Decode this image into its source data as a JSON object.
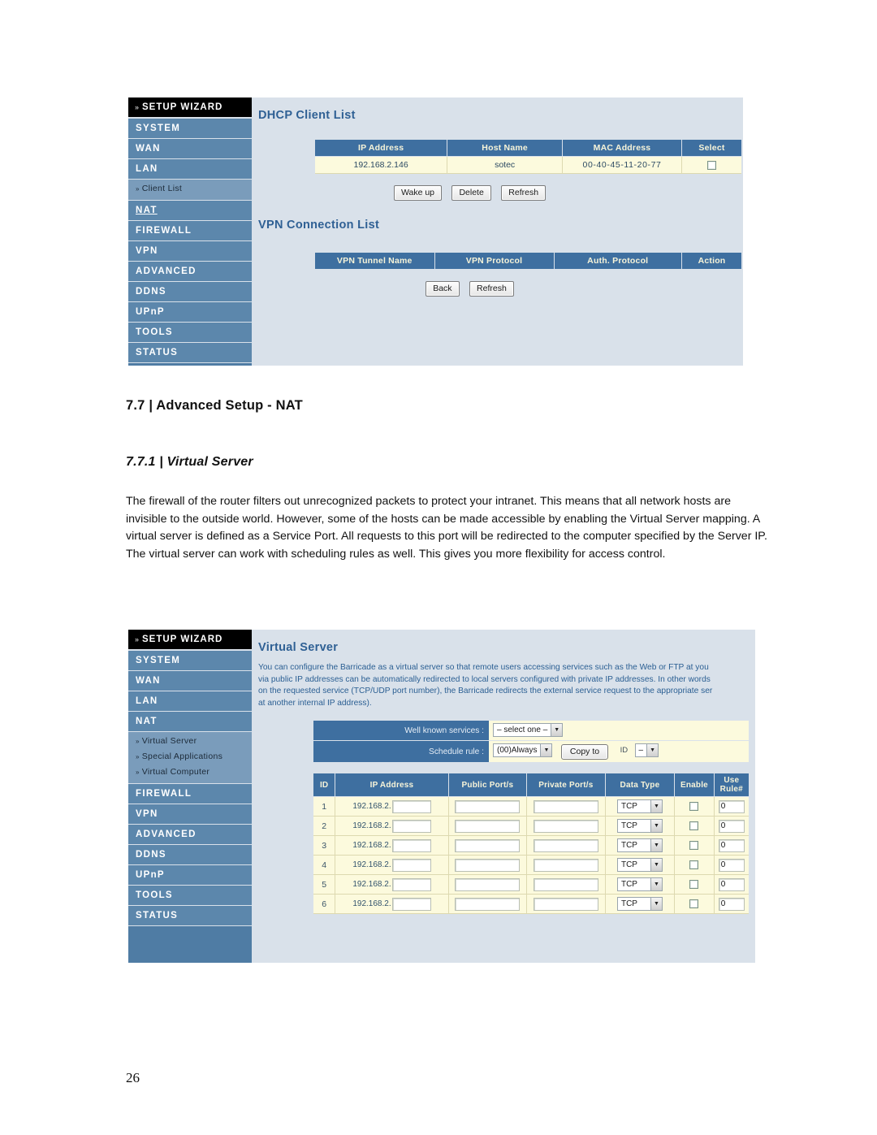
{
  "document": {
    "heading": "7.7 | Advanced Setup - NAT",
    "subheading": "7.7.1 | Virtual Server",
    "paragraph1": "The firewall of the router filters out unrecognized packets to protect your intranet. This means that all network hosts are invisible to the outside world. However, some of the hosts can be made accessible by enabling the Virtual Server mapping. A virtual server is defined as a Service Port. All requests to this port will be redirected to the computer specified by the Server IP.",
    "paragraph2": "The virtual server can work with scheduling rules as well. This gives you more flexibility for access control.",
    "page_number": "26"
  },
  "colors": {
    "sidebar_bg": "#4f7ca4",
    "nav_item_bg": "#5c87ac",
    "sub_group_bg": "#7a9cbb",
    "content_bg": "#d9e1ea",
    "table_header_bg": "#3e6fa0",
    "table_header_text": "#f7f4d9",
    "table_cell_bg": "#fcfadd",
    "title_text": "#2f6094"
  },
  "screenshot1": {
    "sidebar": {
      "wizard_label": "SETUP WIZARD",
      "chevron": "»",
      "items": [
        {
          "label": "SYSTEM",
          "type": "main"
        },
        {
          "label": "WAN",
          "type": "main"
        },
        {
          "label": "LAN",
          "type": "main"
        },
        {
          "label": "Client List",
          "type": "sub"
        },
        {
          "label": "NAT",
          "type": "main",
          "state": "underlined"
        },
        {
          "label": "FIREWALL",
          "type": "main"
        },
        {
          "label": "VPN",
          "type": "main"
        },
        {
          "label": "ADVANCED",
          "type": "main"
        },
        {
          "label": "DDNS",
          "type": "main"
        },
        {
          "label": "UPnP",
          "type": "main"
        },
        {
          "label": "TOOLS",
          "type": "main"
        },
        {
          "label": "STATUS",
          "type": "main"
        }
      ]
    },
    "dhcp": {
      "title": "DHCP Client List",
      "columns": [
        "IP Address",
        "Host Name",
        "MAC Address",
        "Select"
      ],
      "rows": [
        {
          "ip": "192.168.2.146",
          "host": "sotec",
          "mac": "00-40-45-11-20-77",
          "selected": false
        }
      ],
      "buttons": [
        "Wake up",
        "Delete",
        "Refresh"
      ]
    },
    "vpn": {
      "title": "VPN Connection List",
      "columns": [
        "VPN Tunnel Name",
        "VPN Protocol",
        "Auth. Protocol",
        "Action"
      ],
      "rows": [],
      "buttons": [
        "Back",
        "Refresh"
      ]
    }
  },
  "screenshot2": {
    "sidebar": {
      "wizard_label": "SETUP WIZARD",
      "chevron": "»",
      "items": [
        {
          "label": "SYSTEM",
          "type": "main"
        },
        {
          "label": "WAN",
          "type": "main"
        },
        {
          "label": "LAN",
          "type": "main"
        },
        {
          "label": "NAT",
          "type": "main"
        },
        {
          "label": "Virtual Server",
          "type": "sub"
        },
        {
          "label": "Special Applications",
          "type": "sub"
        },
        {
          "label": "Virtual Computer",
          "type": "sub"
        },
        {
          "label": "FIREWALL",
          "type": "main"
        },
        {
          "label": "VPN",
          "type": "main"
        },
        {
          "label": "ADVANCED",
          "type": "main"
        },
        {
          "label": "DDNS",
          "type": "main"
        },
        {
          "label": "UPnP",
          "type": "main"
        },
        {
          "label": "TOOLS",
          "type": "main"
        },
        {
          "label": "STATUS",
          "type": "main"
        }
      ]
    },
    "panel": {
      "title": "Virtual Server",
      "description_lines": [
        "You can configure the Barricade as a virtual server so that remote users accessing services such as the Web or FTP at you",
        "via public IP addresses can be automatically redirected to local servers configured with private IP addresses. In other words",
        "on the requested service (TCP/UDP port number), the Barricade redirects the external service request to the appropriate ser",
        "at another internal IP address)."
      ],
      "form": {
        "well_known_label": "Well known services :",
        "well_known_value": "– select one –",
        "schedule_label": "Schedule rule :",
        "schedule_value": "(00)Always",
        "copy_button": "Copy to",
        "id_label": "ID",
        "id_value": "–"
      },
      "table": {
        "columns": [
          "ID",
          "IP Address",
          "Public Port/s",
          "Private Port/s",
          "Data Type",
          "Enable",
          "Use Rule#"
        ],
        "use_rule_header_line1": "Use",
        "use_rule_header_line2": "Rule#",
        "ip_prefix": "192.168.2.",
        "rows": [
          {
            "id": "1",
            "ip_suffix": "",
            "public_port": "",
            "private_port": "",
            "data_type": "TCP",
            "enable": false,
            "use_rule": "0"
          },
          {
            "id": "2",
            "ip_suffix": "",
            "public_port": "",
            "private_port": "",
            "data_type": "TCP",
            "enable": false,
            "use_rule": "0"
          },
          {
            "id": "3",
            "ip_suffix": "",
            "public_port": "",
            "private_port": "",
            "data_type": "TCP",
            "enable": false,
            "use_rule": "0"
          },
          {
            "id": "4",
            "ip_suffix": "",
            "public_port": "",
            "private_port": "",
            "data_type": "TCP",
            "enable": false,
            "use_rule": "0"
          },
          {
            "id": "5",
            "ip_suffix": "",
            "public_port": "",
            "private_port": "",
            "data_type": "TCP",
            "enable": false,
            "use_rule": "0"
          },
          {
            "id": "6",
            "ip_suffix": "",
            "public_port": "",
            "private_port": "",
            "data_type": "TCP",
            "enable": false,
            "use_rule": "0"
          }
        ]
      }
    }
  }
}
